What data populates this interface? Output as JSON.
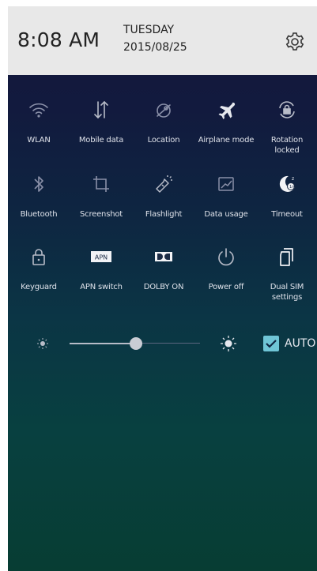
{
  "header": {
    "time": "8:08 AM",
    "day": "TUESDAY",
    "date": "2015/08/25",
    "settings_icon": "gear-icon"
  },
  "tiles": [
    {
      "label": "WLAN",
      "icon": "wifi-icon"
    },
    {
      "label": "Mobile data",
      "icon": "mobile-data-icon"
    },
    {
      "label": "Location",
      "icon": "location-icon"
    },
    {
      "label": "Airplane mode",
      "icon": "airplane-icon"
    },
    {
      "label": "Rotation\nlocked",
      "icon": "rotation-lock-icon"
    },
    {
      "label": "Bluetooth",
      "icon": "bluetooth-icon"
    },
    {
      "label": "Screenshot",
      "icon": "screenshot-icon"
    },
    {
      "label": "Flashlight",
      "icon": "flashlight-icon"
    },
    {
      "label": "Data usage",
      "icon": "data-usage-icon"
    },
    {
      "label": "Timeout",
      "icon": "timeout-icon"
    },
    {
      "label": "Keyguard",
      "icon": "lock-icon"
    },
    {
      "label": "APN switch",
      "icon": "apn-icon",
      "icon_text": "APN"
    },
    {
      "label": "DOLBY ON",
      "icon": "dolby-icon"
    },
    {
      "label": "Power off",
      "icon": "power-icon"
    },
    {
      "label": "Dual SIM\nsettings",
      "icon": "dual-sim-icon"
    }
  ],
  "brightness": {
    "level": 0.51,
    "auto_checked": true,
    "auto_label": "AUTO"
  },
  "colors": {
    "header_bg": "#e8e8e8",
    "accent": "#6fc5d6",
    "panel_top": "#16163a",
    "panel_bottom": "#073d33"
  }
}
